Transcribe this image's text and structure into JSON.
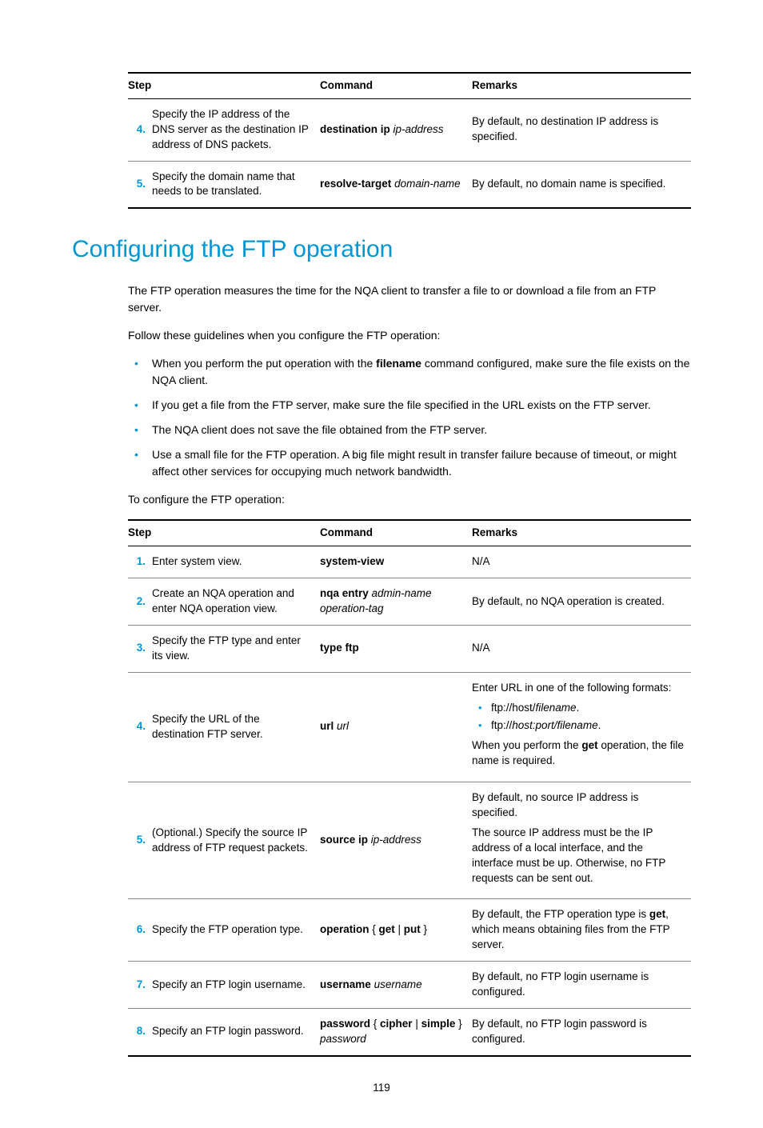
{
  "table1": {
    "headers": {
      "step": "Step",
      "command": "Command",
      "remarks": "Remarks"
    },
    "rows": [
      {
        "num": "4.",
        "step": "Specify the IP address of the DNS server as the destination IP address of DNS packets.",
        "cmd_bold": "destination ip",
        "cmd_ital": "ip-address",
        "remarks": "By default, no destination IP address is specified."
      },
      {
        "num": "5.",
        "step": "Specify the domain name that needs to be translated.",
        "cmd_bold": "resolve-target",
        "cmd_ital": "domain-name",
        "remarks": "By default, no domain name is specified."
      }
    ]
  },
  "heading": "Configuring the FTP operation",
  "intro": "The FTP operation measures the time for the NQA client to transfer a file to or download a file from an FTP server.",
  "guidelines_intro": "Follow these guidelines when you configure the FTP operation:",
  "bullets": {
    "b1a": "When you perform the put operation with the ",
    "b1b": "filename",
    "b1c": " command configured, make sure the file exists on the NQA client.",
    "b2": "If you get a file from the FTP server, make sure the file specified in the URL exists on the FTP server.",
    "b3": "The NQA client does not save the file obtained from the FTP server.",
    "b4": "Use a small file for the FTP operation. A big file might result in transfer failure because of timeout, or might affect other services for occupying much network bandwidth."
  },
  "configure_intro": "To configure the FTP operation:",
  "table2": {
    "headers": {
      "step": "Step",
      "command": "Command",
      "remarks": "Remarks"
    },
    "rows": {
      "r1": {
        "num": "1.",
        "step": "Enter system view.",
        "cmd": "system-view",
        "remarks": "N/A"
      },
      "r2": {
        "num": "2.",
        "step": "Create an NQA operation and enter NQA operation view.",
        "cmd_bold": "nqa entry",
        "cmd_ital1": "admin-name",
        "cmd_ital2": "operation-tag",
        "remarks": "By default, no NQA operation is created."
      },
      "r3": {
        "num": "3.",
        "step": "Specify the FTP type and enter its view.",
        "cmd": "type ftp",
        "remarks": "N/A"
      },
      "r4": {
        "num": "4.",
        "step": "Specify the URL of the destination FTP server.",
        "cmd_bold": "url",
        "cmd_ital": "url",
        "rem_intro": "Enter URL in one of the following formats:",
        "rem_li1a": "ftp://host/",
        "rem_li1b": "filename",
        "rem_li1c": ".",
        "rem_li2a": "ftp://",
        "rem_li2b": "host:port/filename",
        "rem_li2c": ".",
        "rem_out_a": "When you perform the ",
        "rem_out_b": "get",
        "rem_out_c": " operation, the file name is required."
      },
      "r5": {
        "num": "5.",
        "step": "(Optional.) Specify the source IP address of FTP request packets.",
        "cmd_bold": "source ip",
        "cmd_ital": "ip-address",
        "rem_p1": "By default, no source IP address is specified.",
        "rem_p2": "The source IP address must be the IP address of a local interface, and the interface must be up. Otherwise, no FTP requests can be sent out."
      },
      "r6": {
        "num": "6.",
        "step": "Specify the FTP operation type.",
        "cmd_a": "operation",
        "cmd_b": " { ",
        "cmd_c": "get",
        "cmd_d": " | ",
        "cmd_e": "put",
        "cmd_f": " }",
        "rem_a": "By default, the FTP operation type is ",
        "rem_b": "get",
        "rem_c": ", which means obtaining files from the FTP server."
      },
      "r7": {
        "num": "7.",
        "step": "Specify an FTP login username.",
        "cmd_bold": "username",
        "cmd_ital": "username",
        "remarks": "By default, no FTP login username is configured."
      },
      "r8": {
        "num": "8.",
        "step": "Specify an FTP login password.",
        "cmd_a": "password",
        "cmd_b": " { ",
        "cmd_c": "cipher",
        "cmd_d": " | ",
        "cmd_e": "simple",
        "cmd_f": " } ",
        "cmd_g": "password",
        "remarks": "By default, no FTP login password is configured."
      }
    }
  },
  "page_number": "119"
}
